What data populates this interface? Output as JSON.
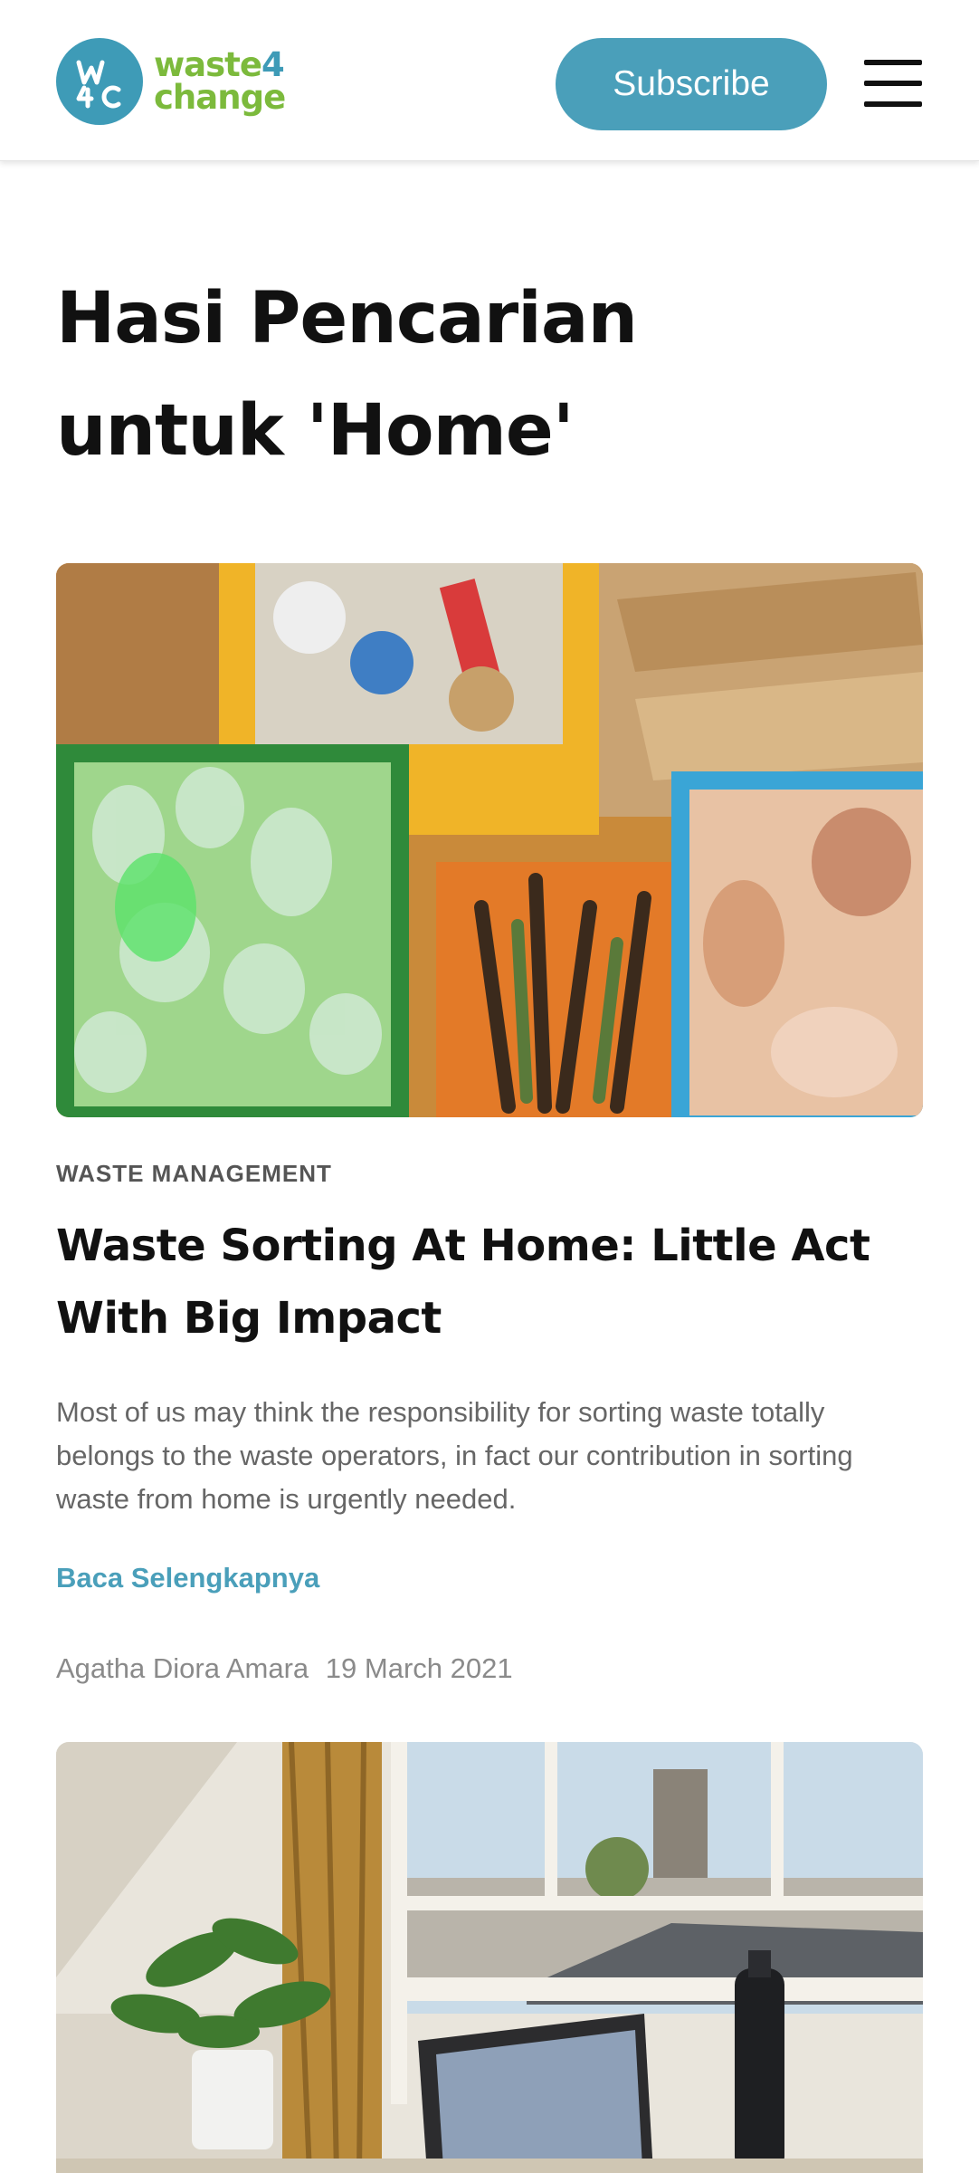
{
  "header": {
    "logo": {
      "line1": "waste",
      "line1_number": "4",
      "line2": "change",
      "badge_text": "W4C"
    },
    "subscribe_label": "Subscribe",
    "menu_icon": "hamburger-menu-icon"
  },
  "page": {
    "title": "Hasi Pencarian untuk 'Home'"
  },
  "articles": [
    {
      "image": "recycling-bins-photo",
      "category": "WASTE MANAGEMENT",
      "title": "Waste Sorting At Home: Little Act With Big Impact",
      "excerpt": "Most of us may think the responsibility for sorting waste totally belongs to the waste operators, in fact our contribution in sorting waste from home is urgently needed.",
      "read_more": "Baca Selengkapnya",
      "author": "Agatha Diora Amara",
      "date": "19 March 2021"
    },
    {
      "image": "home-office-window-photo"
    }
  ],
  "colors": {
    "brand_blue": "#4a9fba",
    "brand_green": "#7cba3c",
    "text_dark": "#111111",
    "text_muted": "#666666"
  }
}
